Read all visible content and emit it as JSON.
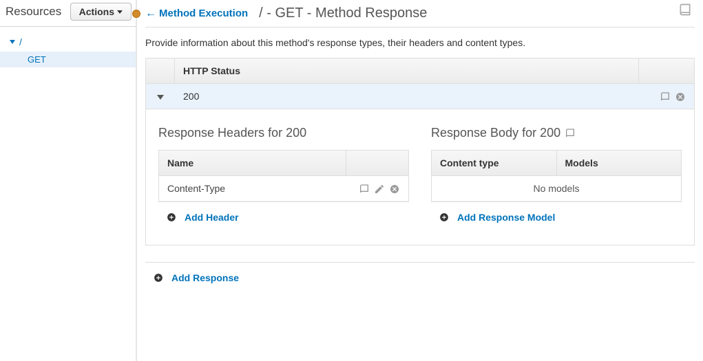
{
  "sidebar": {
    "title": "Resources",
    "actionsLabel": "Actions",
    "root": "/",
    "children": [
      {
        "label": "GET",
        "selected": true
      }
    ]
  },
  "header": {
    "backLink": "Method Execution",
    "pageTitle": "/ - GET - Method Response"
  },
  "description": "Provide information about this method's response types, their headers and content types.",
  "statusTable": {
    "header": "HTTP Status",
    "rows": [
      {
        "code": "200",
        "expanded": true
      }
    ]
  },
  "responseHeadersPanel": {
    "title": "Response Headers for 200",
    "columns": [
      "Name"
    ],
    "rows": [
      {
        "name": "Content-Type"
      }
    ],
    "addLabel": "Add Header"
  },
  "responseBodyPanel": {
    "title": "Response Body for 200",
    "columns": [
      "Content type",
      "Models"
    ],
    "emptyText": "No models",
    "addLabel": "Add Response Model"
  },
  "addResponseLabel": "Add Response"
}
